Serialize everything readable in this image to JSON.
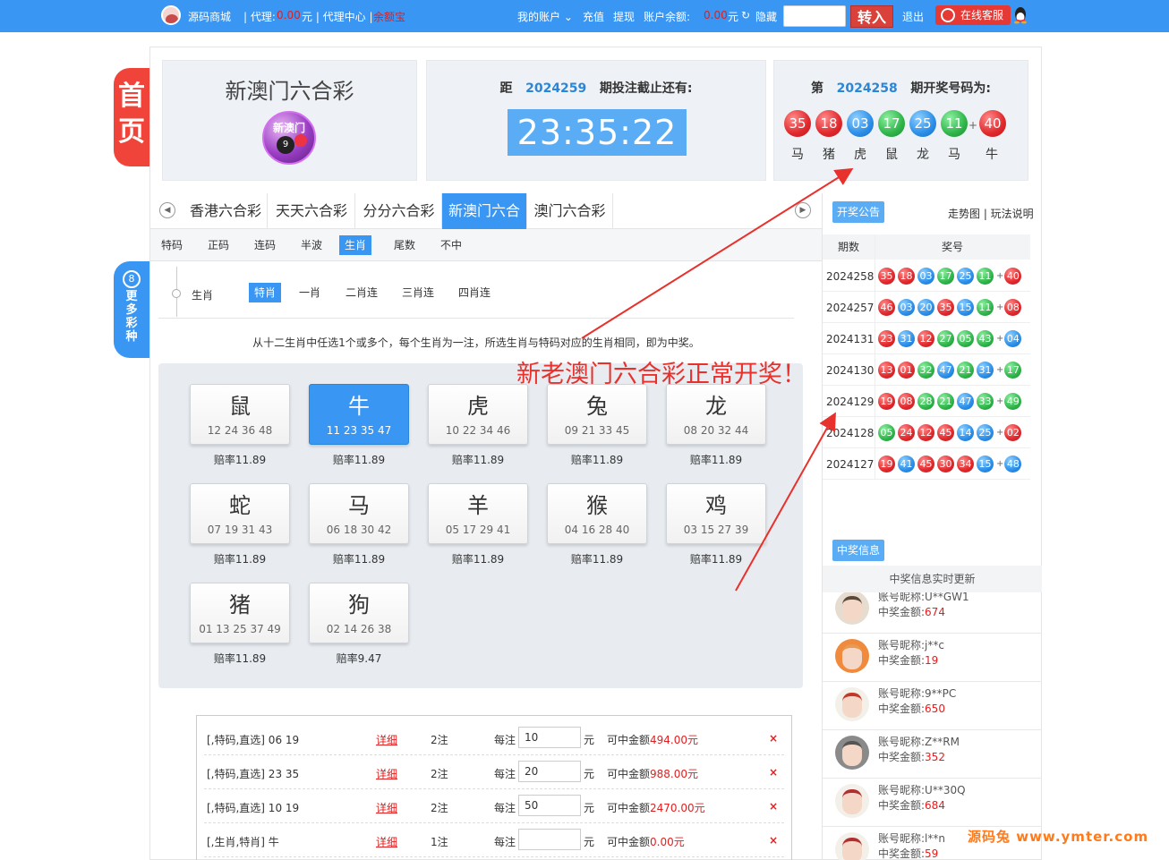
{
  "topbar": {
    "site_name": "源码商城",
    "agent_label": "| 代理:",
    "agent_amount": "0.00",
    "agent_unit": "元 | 代理中心 |",
    "balance_link": "余额宝",
    "my_account": "我的账户",
    "recharge": "充值",
    "withdraw": "提现",
    "balance_label": "账户余额:",
    "balance_amount": "0.00",
    "balance_unit": "元",
    "hide": "隐藏",
    "transfer_btn": "转入",
    "logout": "退出",
    "service_btn": "在线客服"
  },
  "side": {
    "home": "首页",
    "more_num": "8",
    "more": "更多彩种"
  },
  "game": {
    "title": "新澳门六合彩",
    "logo_text": "新澳门",
    "logo_ball": "9"
  },
  "countdown": {
    "prefix": "距",
    "issue": "2024259",
    "suffix": "期投注截止还有:",
    "time": "23:35:22"
  },
  "lastdraw": {
    "prefix": "第",
    "issue": "2024258",
    "suffix": "期开奖号码为:",
    "balls": [
      {
        "num": "35",
        "color": "red",
        "zodiac": "马"
      },
      {
        "num": "18",
        "color": "red",
        "zodiac": "猪"
      },
      {
        "num": "03",
        "color": "blue",
        "zodiac": "虎"
      },
      {
        "num": "17",
        "color": "green",
        "zodiac": "鼠"
      },
      {
        "num": "25",
        "color": "blue",
        "zodiac": "龙"
      },
      {
        "num": "11",
        "color": "green",
        "zodiac": "马"
      },
      {
        "num": "40",
        "color": "red",
        "zodiac": "牛"
      }
    ],
    "plus": "+"
  },
  "tabs": [
    "香港六合彩",
    "天天六合彩",
    "分分六合彩",
    "新澳门六合",
    "澳门六合彩"
  ],
  "subtabs": [
    "特码",
    "正码",
    "连码",
    "半波",
    "生肖",
    "尾数",
    "不中"
  ],
  "play": {
    "label": "生肖",
    "options": [
      "特肖",
      "一肖",
      "二肖连",
      "三肖连",
      "四肖连"
    ]
  },
  "description": "从十二生肖中任选1个或多个，每个生肖为一注，所选生肖与特码对应的生肖相同，即为中奖。",
  "zodiacs": [
    {
      "name": "鼠",
      "nums": "12 24 36 48",
      "odds": "赔率11.89"
    },
    {
      "name": "牛",
      "nums": "11 23 35 47",
      "odds": "赔率11.89"
    },
    {
      "name": "虎",
      "nums": "10 22 34 46",
      "odds": "赔率11.89"
    },
    {
      "name": "兔",
      "nums": "09 21 33 45",
      "odds": "赔率11.89"
    },
    {
      "name": "龙",
      "nums": "08 20 32 44",
      "odds": "赔率11.89"
    },
    {
      "name": "蛇",
      "nums": "07 19 31 43",
      "odds": "赔率11.89"
    },
    {
      "name": "马",
      "nums": "06 18 30 42",
      "odds": "赔率11.89"
    },
    {
      "name": "羊",
      "nums": "05 17 29 41",
      "odds": "赔率11.89"
    },
    {
      "name": "猴",
      "nums": "04 16 28 40",
      "odds": "赔率11.89"
    },
    {
      "name": "鸡",
      "nums": "03 15 27 39",
      "odds": "赔率11.89"
    },
    {
      "name": "猪",
      "nums": "01 13 25 37 49",
      "odds": "赔率11.89"
    },
    {
      "name": "狗",
      "nums": "02 14 26 38",
      "odds": "赔率9.47"
    }
  ],
  "bets": [
    {
      "desc": "[,特码,直选] 06 19",
      "detail": "详细",
      "count": "2注",
      "each": "每注",
      "amount": "10",
      "unit": "元",
      "win_label": "可中金额",
      "win": "494.00元",
      "del": "×"
    },
    {
      "desc": "[,特码,直选] 23 35",
      "detail": "详细",
      "count": "2注",
      "each": "每注",
      "amount": "20",
      "unit": "元",
      "win_label": "可中金额",
      "win": "988.00元",
      "del": "×"
    },
    {
      "desc": "[,特码,直选] 10 19",
      "detail": "详细",
      "count": "2注",
      "each": "每注",
      "amount": "50",
      "unit": "元",
      "win_label": "可中金额",
      "win": "2470.00元",
      "del": "×"
    },
    {
      "desc": "[,生肖,特肖] 牛",
      "detail": "详细",
      "count": "1注",
      "each": "每注",
      "amount": "",
      "unit": "元",
      "win_label": "可中金额",
      "win": "0.00元",
      "del": "×"
    }
  ],
  "results": {
    "title": "开奖公告",
    "links": "走势图 | 玩法说明",
    "col_issue": "期数",
    "col_nums": "奖号",
    "rows": [
      {
        "issue": "2024258",
        "balls": [
          [
            "35",
            "red"
          ],
          [
            "18",
            "red"
          ],
          [
            "03",
            "blue"
          ],
          [
            "17",
            "green"
          ],
          [
            "25",
            "blue"
          ],
          [
            "11",
            "green"
          ]
        ],
        "special": [
          "40",
          "red"
        ]
      },
      {
        "issue": "2024257",
        "balls": [
          [
            "46",
            "red"
          ],
          [
            "03",
            "blue"
          ],
          [
            "20",
            "blue"
          ],
          [
            "35",
            "red"
          ],
          [
            "15",
            "blue"
          ],
          [
            "11",
            "green"
          ]
        ],
        "special": [
          "08",
          "red"
        ]
      },
      {
        "issue": "2024131",
        "balls": [
          [
            "23",
            "red"
          ],
          [
            "31",
            "blue"
          ],
          [
            "12",
            "red"
          ],
          [
            "27",
            "green"
          ],
          [
            "05",
            "green"
          ],
          [
            "43",
            "green"
          ]
        ],
        "special": [
          "04",
          "blue"
        ]
      },
      {
        "issue": "2024130",
        "balls": [
          [
            "13",
            "red"
          ],
          [
            "01",
            "red"
          ],
          [
            "32",
            "green"
          ],
          [
            "47",
            "blue"
          ],
          [
            "21",
            "green"
          ],
          [
            "31",
            "blue"
          ]
        ],
        "special": [
          "17",
          "green"
        ]
      },
      {
        "issue": "2024129",
        "balls": [
          [
            "19",
            "red"
          ],
          [
            "08",
            "red"
          ],
          [
            "28",
            "green"
          ],
          [
            "21",
            "green"
          ],
          [
            "47",
            "blue"
          ],
          [
            "33",
            "green"
          ]
        ],
        "special": [
          "49",
          "green"
        ]
      },
      {
        "issue": "2024128",
        "balls": [
          [
            "05",
            "green"
          ],
          [
            "24",
            "red"
          ],
          [
            "12",
            "red"
          ],
          [
            "45",
            "red"
          ],
          [
            "14",
            "blue"
          ],
          [
            "25",
            "blue"
          ]
        ],
        "special": [
          "02",
          "red"
        ]
      },
      {
        "issue": "2024127",
        "balls": [
          [
            "19",
            "red"
          ],
          [
            "41",
            "blue"
          ],
          [
            "45",
            "red"
          ],
          [
            "30",
            "red"
          ],
          [
            "34",
            "red"
          ],
          [
            "15",
            "blue"
          ]
        ],
        "special": [
          "48",
          "blue"
        ]
      }
    ]
  },
  "winners": {
    "title": "中奖信息",
    "subtitle": "中奖信息实时更新",
    "nick_label": "账号昵称:",
    "amount_label": "中奖金额:",
    "list": [
      {
        "nick": "U**GW1",
        "amount": "674"
      },
      {
        "nick": "j**c",
        "amount": "19"
      },
      {
        "nick": "9**PC",
        "amount": "650"
      },
      {
        "nick": "Z**RM",
        "amount": "352"
      },
      {
        "nick": "U**30Q",
        "amount": "684"
      },
      {
        "nick": "l**n",
        "amount": "59"
      }
    ]
  },
  "overlay": "新老澳门六合彩正常开奖！",
  "watermark": "源码兔 www.ymter.com",
  "colors": {
    "primary": "#3a96f3",
    "red": "#e0282c",
    "blue": "#2b8ee8",
    "green": "#2fb54a",
    "annotation": "#e8312c"
  }
}
